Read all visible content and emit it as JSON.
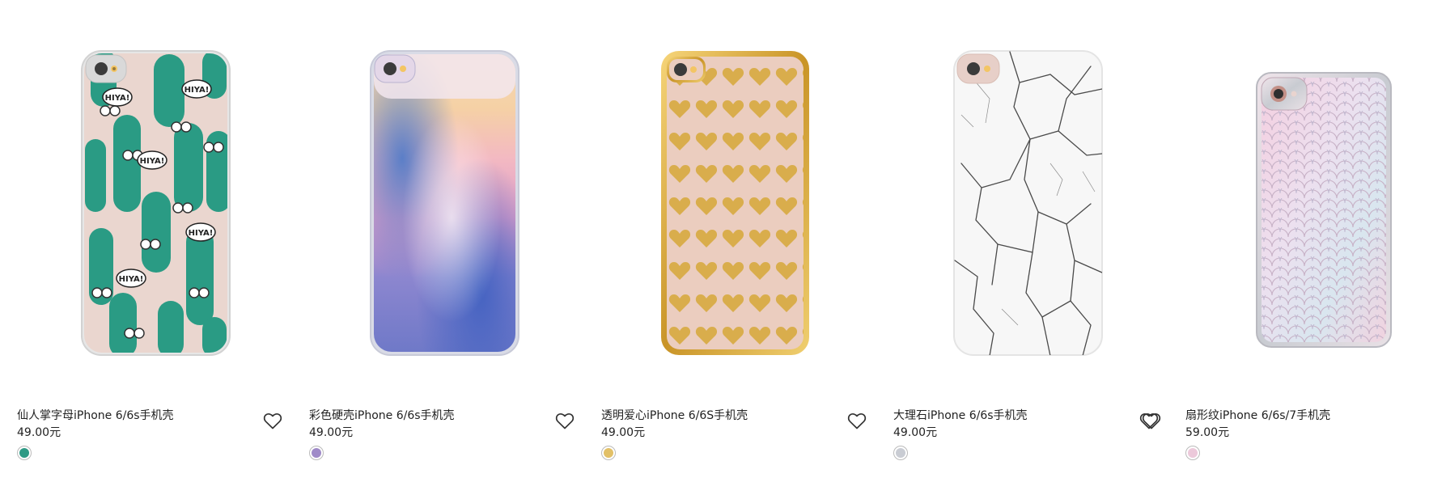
{
  "products": [
    {
      "name": "仙人掌字母iPhone 6/6s手机壳",
      "price": "49.00元",
      "swatch_color": "#2f9a85",
      "theme": "cactus",
      "bubble": "HIYA!"
    },
    {
      "name": "彩色硬壳iPhone 6/6s手机壳",
      "price": "49.00元",
      "swatch_color": "#9f8ac8",
      "theme": "galaxy"
    },
    {
      "name": "透明爱心iPhone 6/6S手机壳",
      "price": "49.00元",
      "swatch_color": "#e2c067",
      "theme": "hearts"
    },
    {
      "name": "大理石iPhone 6/6s手机壳",
      "price": "49.00元",
      "swatch_color": "#c9ccd3",
      "theme": "marble"
    },
    {
      "name": "扇形纹iPhone 6/6s/7手机壳",
      "price": "59.00元",
      "swatch_color": "#ecc9da",
      "theme": "scales"
    }
  ]
}
